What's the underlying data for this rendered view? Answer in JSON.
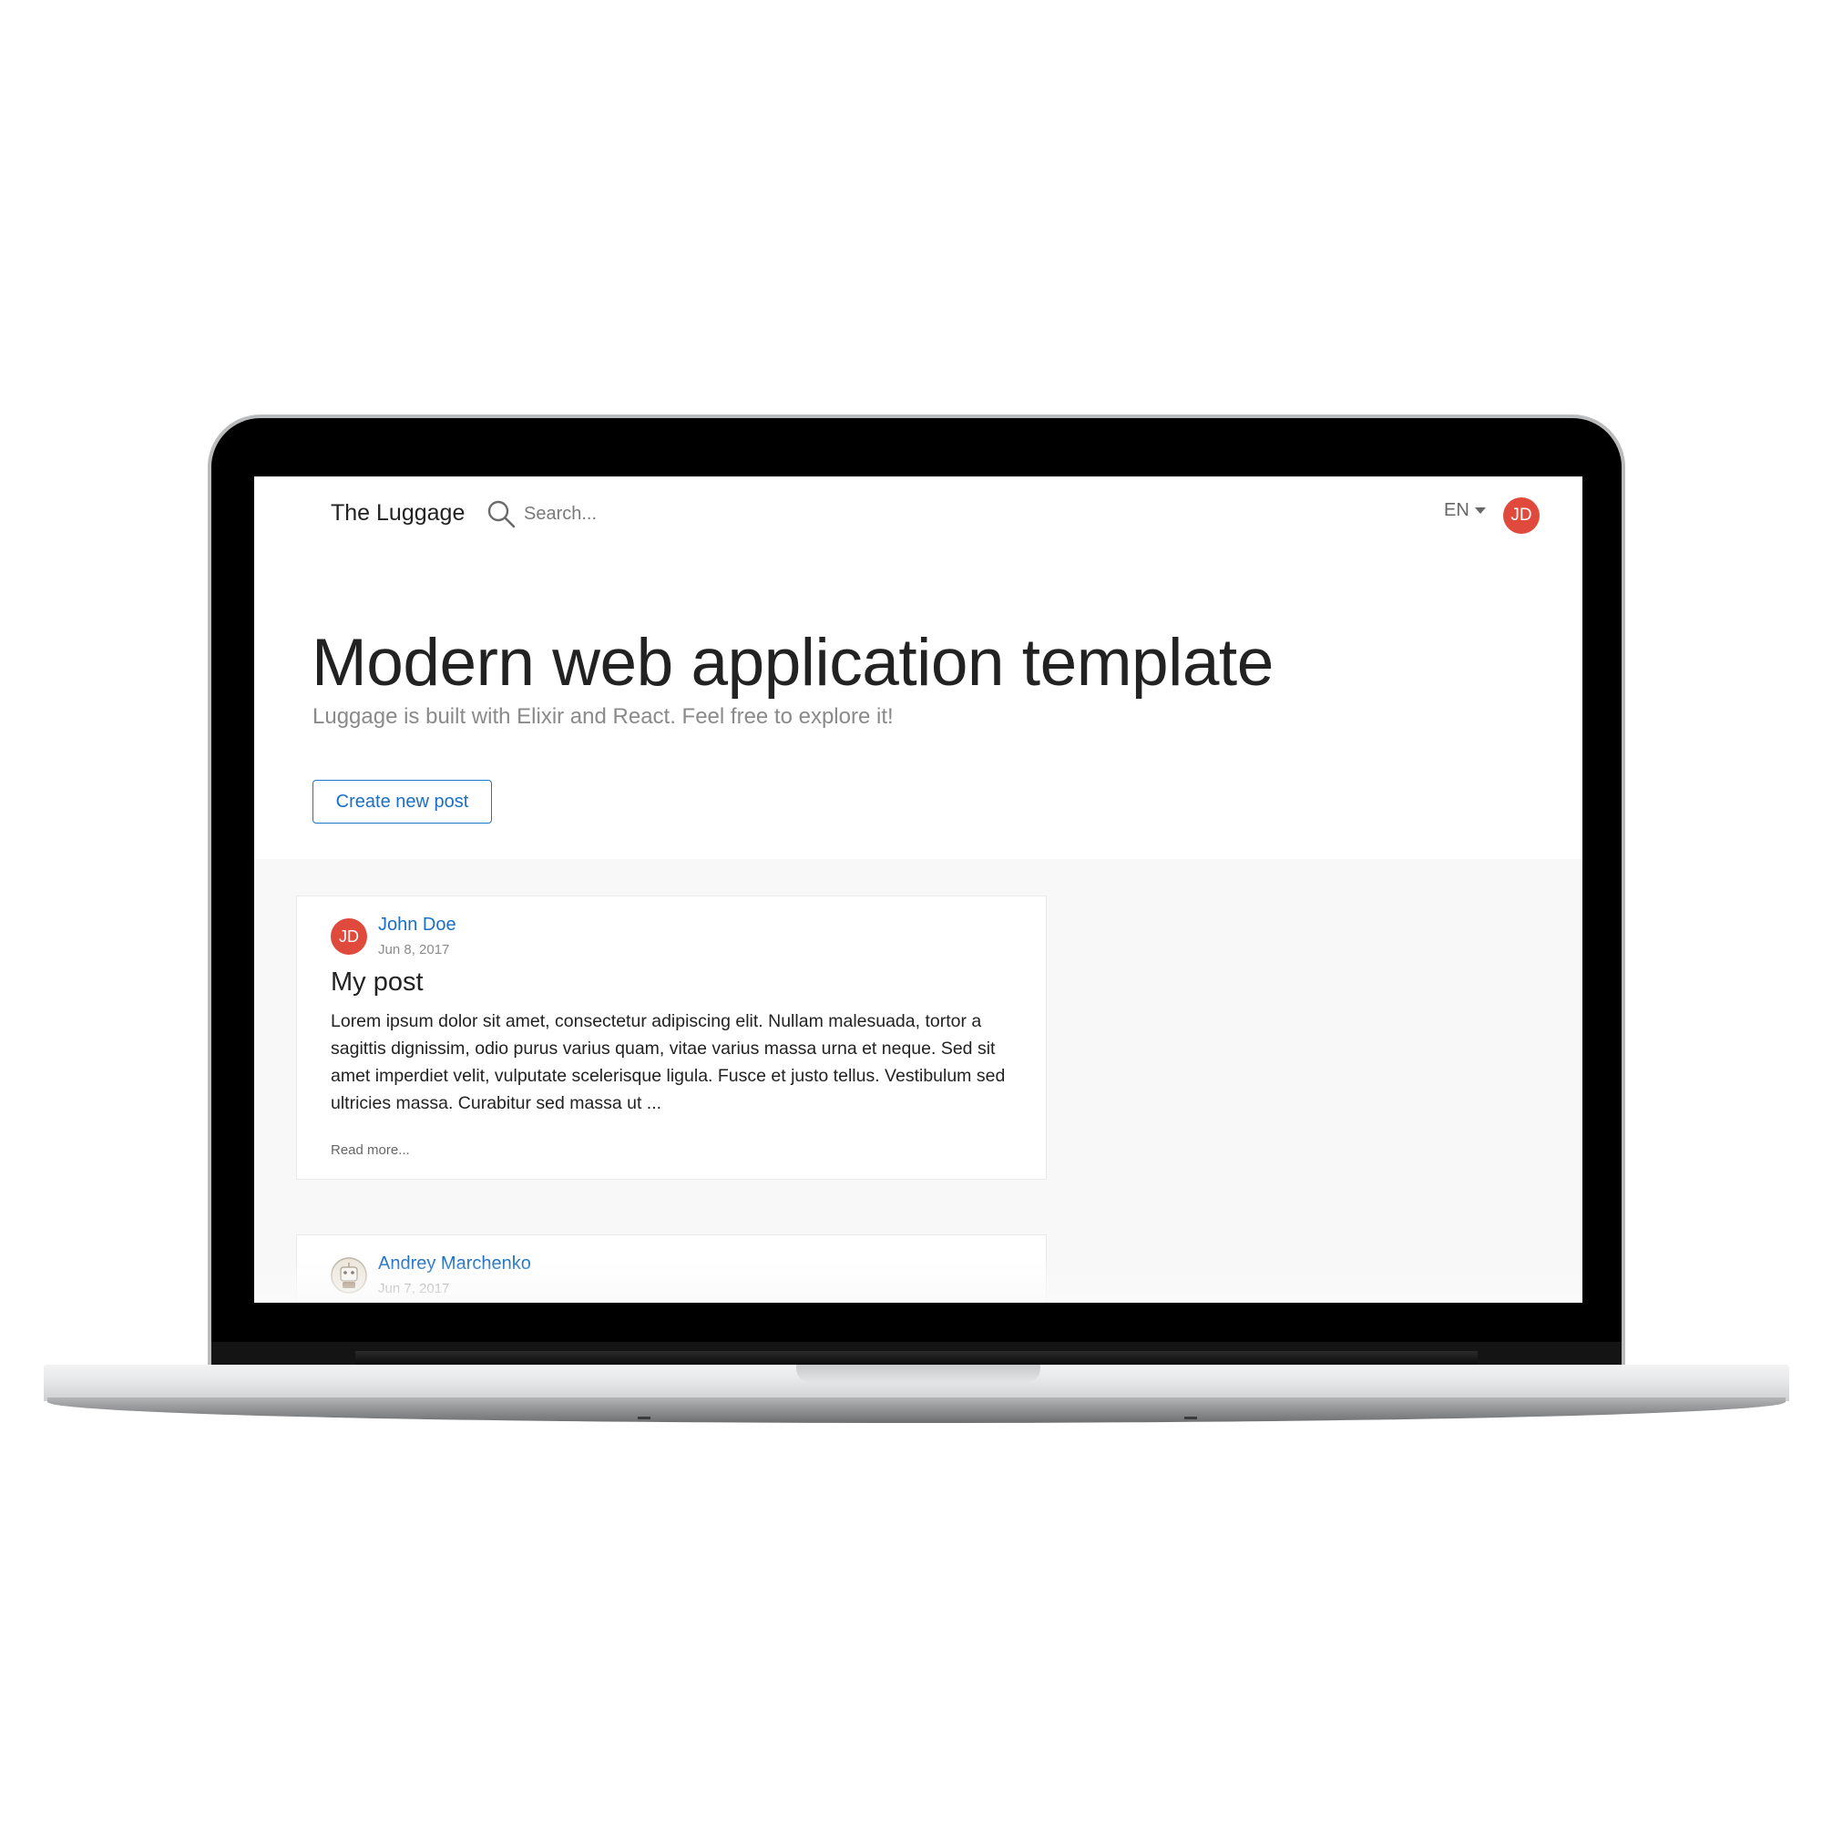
{
  "navbar": {
    "brand": "The Luggage",
    "search_placeholder": "Search...",
    "language": "EN",
    "user_initials": "JD"
  },
  "hero": {
    "title": "Modern web application template",
    "subtitle": "Luggage is built with Elixir and React. Feel free to explore it!",
    "create_button": "Create new post"
  },
  "posts": [
    {
      "author": "John Doe",
      "initials": "JD",
      "date": "Jun 8, 2017",
      "title": "My post",
      "excerpt": "Lorem ipsum dolor sit amet, consectetur adipiscing elit. Nullam malesuada, tortor a sagittis dignissim, odio purus varius quam, vitae varius massa urna et neque. Sed sit amet imperdiet velit, vulputate scelerisque ligula. Fusce et justo tellus. Vestibulum sed ultricies massa. Curabitur sed massa ut ...",
      "read_more": "Read more..."
    },
    {
      "author": "Andrey Marchenko",
      "date": "Jun 7, 2017",
      "avatar_icon": "robot-avatar-icon"
    }
  ],
  "colors": {
    "accent": "#1a6fc4",
    "avatar": "#e04a3c",
    "feed_background": "#f8f8f8"
  }
}
